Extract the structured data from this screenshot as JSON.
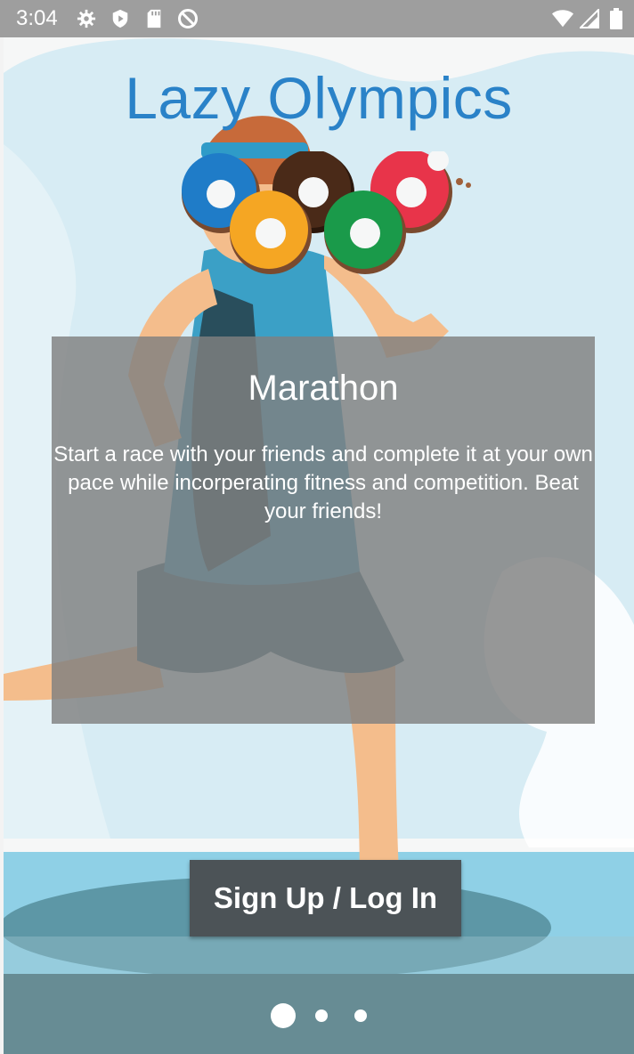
{
  "status_bar": {
    "time": "3:04",
    "left_icons": [
      "gear-icon",
      "shield-play-icon",
      "sd-card-icon",
      "do-not-disturb-icon"
    ],
    "right_icons": [
      "wifi-icon",
      "signal-icon",
      "battery-icon"
    ]
  },
  "app": {
    "title": "Lazy Olympics",
    "logo": {
      "ring_colors": [
        "#1f7cc8",
        "#f5a623",
        "#4a2a18",
        "#1a9a4a",
        "#e8344a"
      ]
    }
  },
  "slide": {
    "heading": "Marathon",
    "description": "Start a race with your friends and complete it at your own pace while incorperating fitness and competition. Beat your friends!"
  },
  "actions": {
    "signup_label": "Sign Up / Log In"
  },
  "pager": {
    "page_count": 3,
    "active_page": 1
  }
}
